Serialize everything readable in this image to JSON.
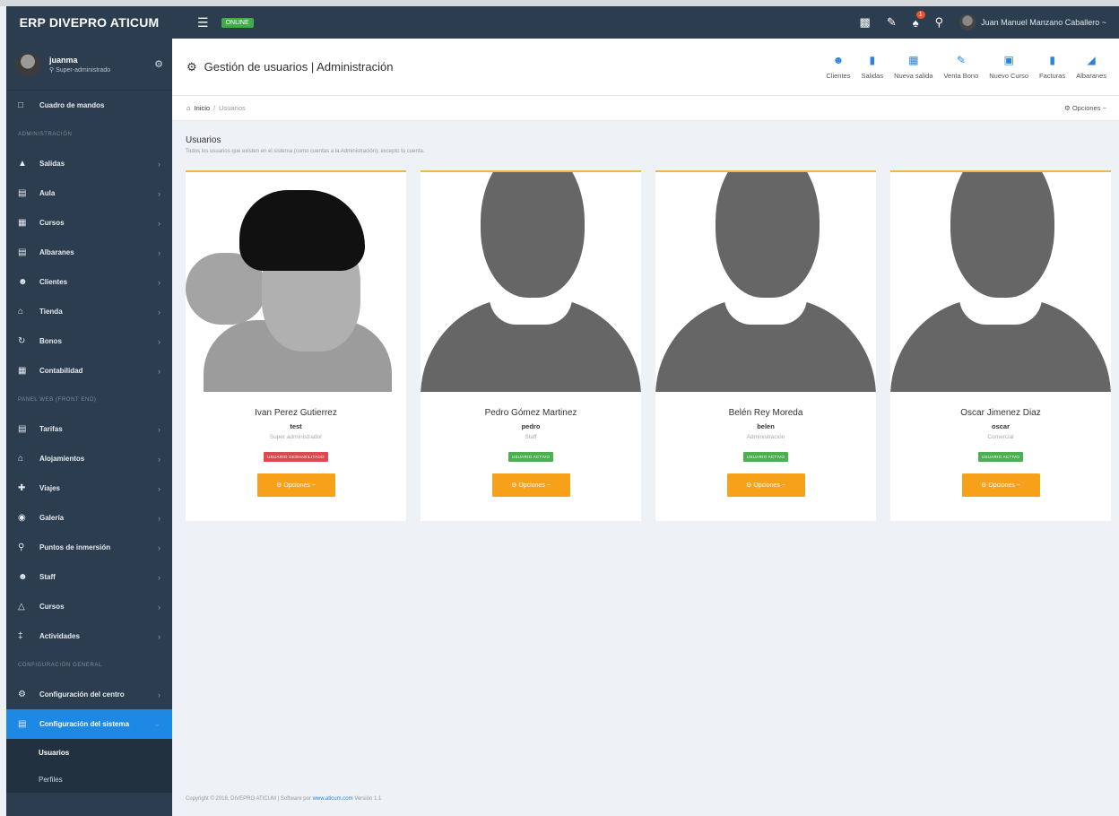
{
  "header": {
    "brand": "ERP DIVEPRO ATICUM",
    "online_badge": "ONLINE",
    "notifications_count": "1",
    "user_name": "Juan Manuel Manzano Caballero ~"
  },
  "sidebar": {
    "profile": {
      "name": "juanma",
      "role": "Super-administrado"
    },
    "dashboard": "Cuadro de mandos",
    "sections": [
      {
        "title": "ADMINISTRACIÓN",
        "items": [
          "Salidas",
          "Aula",
          "Cursos",
          "Albaranes",
          "Clientes",
          "Tienda",
          "Bonos",
          "Contabilidad"
        ]
      },
      {
        "title": "PANEL WEB (FRONT END)",
        "items": [
          "Tarifas",
          "Alojamientos",
          "Viajes",
          "Galería",
          "Puntos de inmersión",
          "Staff",
          "Cursos",
          "Actividades"
        ]
      },
      {
        "title": "CONFIGURACIÓN GENERAL",
        "items": [
          "Configuración del centro",
          "Configuración del sistema"
        ]
      }
    ],
    "submenu": [
      "Usuarios",
      "Perfiles"
    ]
  },
  "page": {
    "title": "Gestión de usuarios | Administración",
    "quick_actions": [
      "Clientes",
      "Salidas",
      "Nueva salida",
      "Venta Bono",
      "Nuevo Curso",
      "Facturas",
      "Albaranes"
    ],
    "breadcrumb": {
      "home": "Inicio",
      "separator": "/",
      "current": "Usuarios"
    },
    "options": "Opciones ~",
    "section_title": "Usuarios",
    "section_desc": "Todos los usuarios que existen en el sistema (como cuentas a la Administración), excepto tu cuenta."
  },
  "users": [
    {
      "name": "Ivan Perez Gutierrez",
      "login": "test",
      "role": "Super administrador",
      "status": "USUARIO DESHABILITADO",
      "button": "Opciones ~"
    },
    {
      "name": "Pedro Gómez Martinez",
      "login": "pedro",
      "role": "Staff",
      "status": "USUARIO ACTIVO",
      "button": "Opciones ~"
    },
    {
      "name": "Belén Rey Moreda",
      "login": "belen",
      "role": "Administración",
      "status": "USUARIO ACTIVO",
      "button": "Opciones ~"
    },
    {
      "name": "Oscar Jimenez Diaz",
      "login": "oscar",
      "role": "Comercial",
      "status": "USUARIO ACTIVO",
      "button": "Opciones ~"
    }
  ],
  "footer": {
    "text": "Copyright © 2018, DIVEPRO ATICUM | Software por",
    "link": "www.aticum.com",
    "version": "Versión 1.1"
  },
  "colors": {
    "sidebar_bg": "#2c3d4f",
    "active_blue": "#1e88e5",
    "orange": "#f7a11a",
    "green": "#4caf50",
    "red": "#e04850"
  }
}
